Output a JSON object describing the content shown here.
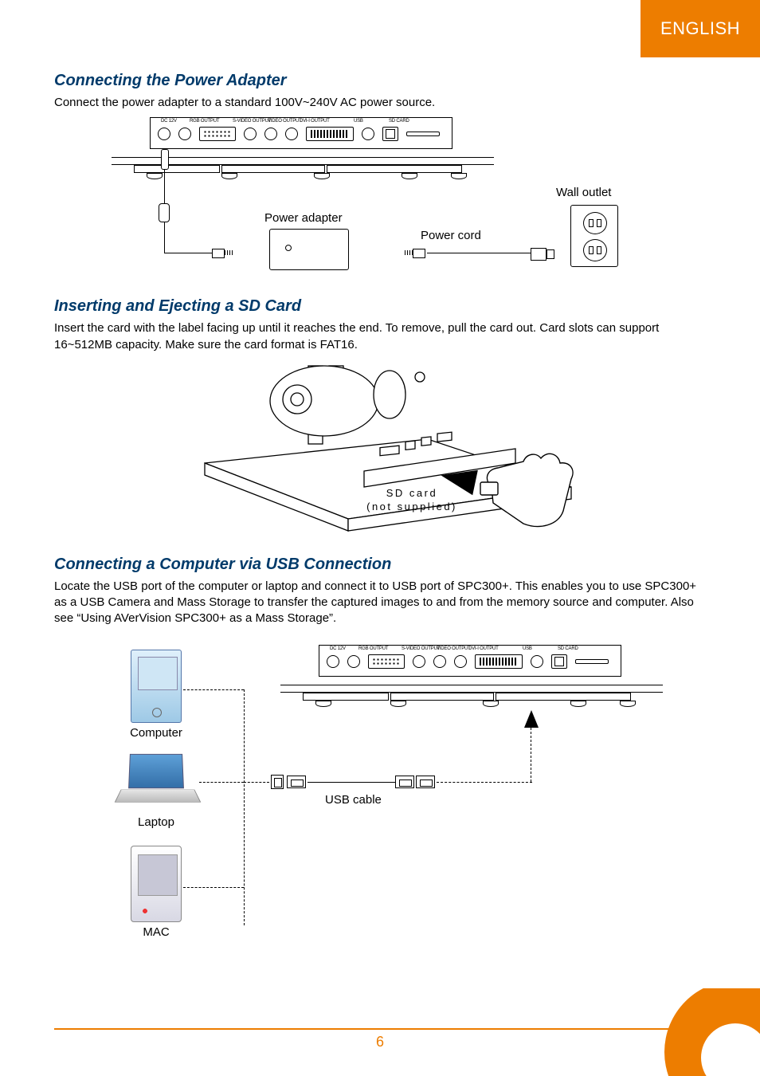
{
  "lang_tab": "ENGLISH",
  "page_number": "6",
  "sections": {
    "power": {
      "title": "Connecting the Power Adapter",
      "body": "Connect the power adapter to a standard 100V~240V AC power source.",
      "labels": {
        "power_adapter": "Power adapter",
        "power_cord": "Power cord",
        "wall_outlet": "Wall outlet"
      },
      "port_labels": {
        "dc": "DC 12V",
        "rgb_out": "RGB OUTPUT",
        "svideo_out": "S-VIDEO OUTPUT",
        "video_out": "VIDEO OUTPUT",
        "dvi_out": "DVI-I OUTPUT",
        "usb": "USB",
        "sd": "SD CARD"
      }
    },
    "sd": {
      "title": "Inserting and Ejecting a SD Card",
      "body": "Insert the card with the label facing up until it reaches the end. To remove, pull the card out. Card slots can support 16~512MB capacity. Make sure the card format is FAT16.",
      "caption_line1": "SD card",
      "caption_line2": "(not supplied)"
    },
    "usb": {
      "title": "Connecting a Computer via USB Connection",
      "body": "Locate the USB port of the computer or laptop and connect it to USB port of SPC300+. This enables you to use SPC300+ as a USB Camera and Mass Storage to transfer the captured images to and from the memory source and computer. Also see “Using AVerVision SPC300+ as a Mass Storage”.",
      "labels": {
        "computer": "Computer",
        "laptop": "Laptop",
        "mac": "MAC",
        "usb_cable": "USB cable"
      },
      "port_labels": {
        "dc": "DC 12V",
        "rgb_out": "RGB OUTPUT",
        "svideo_out": "S-VIDEO OUTPUT",
        "video_out": "VIDEO OUTPUT",
        "dvi_out": "DVI-I OUTPUT",
        "usb": "USB",
        "sd": "SD CARD"
      }
    }
  }
}
